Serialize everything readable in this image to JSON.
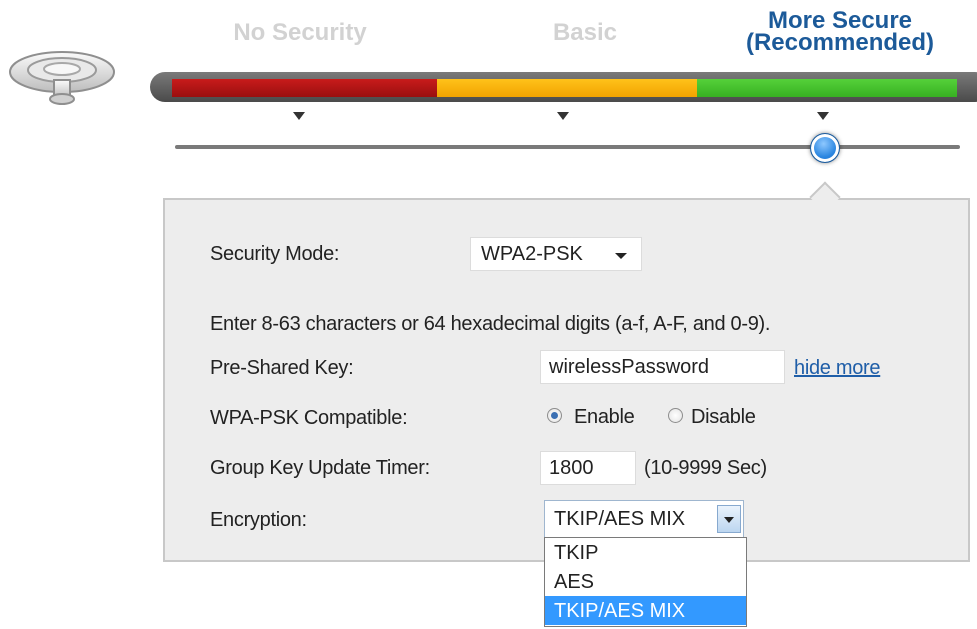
{
  "security_levels": {
    "none": "No Security",
    "basic": "Basic",
    "secure_line1": "More Secure",
    "secure_line2": "(Recommended)",
    "selected_level": 3,
    "level_count": 3
  },
  "colors": {
    "red": "#b01515",
    "orange": "#ffb400",
    "green": "#45c12d",
    "accent": "#1c5a99",
    "link": "#1f5ea8",
    "highlight": "#3399ff"
  },
  "security_mode": {
    "label": "Security Mode:",
    "value": "WPA2-PSK"
  },
  "hint": "Enter 8-63 characters or 64 hexadecimal digits (a-f, A-F, and 0-9).",
  "pre_shared_key": {
    "label": "Pre-Shared Key:",
    "value": "wirelessPassword",
    "toggle_link": "hide more"
  },
  "wpa_psk_compatible": {
    "label": "WPA-PSK Compatible:",
    "enable_label": "Enable",
    "disable_label": "Disable",
    "selected": "Enable"
  },
  "group_key_timer": {
    "label": "Group Key Update Timer:",
    "value": "1800",
    "range": "(10-9999 Sec)"
  },
  "encryption": {
    "label": "Encryption:",
    "value": "TKIP/AES MIX",
    "options": [
      "TKIP",
      "AES",
      "TKIP/AES MIX"
    ],
    "highlighted_option": "TKIP/AES MIX"
  },
  "icons": {
    "router": "router-icon",
    "dropdown": "chevron-down-icon"
  }
}
